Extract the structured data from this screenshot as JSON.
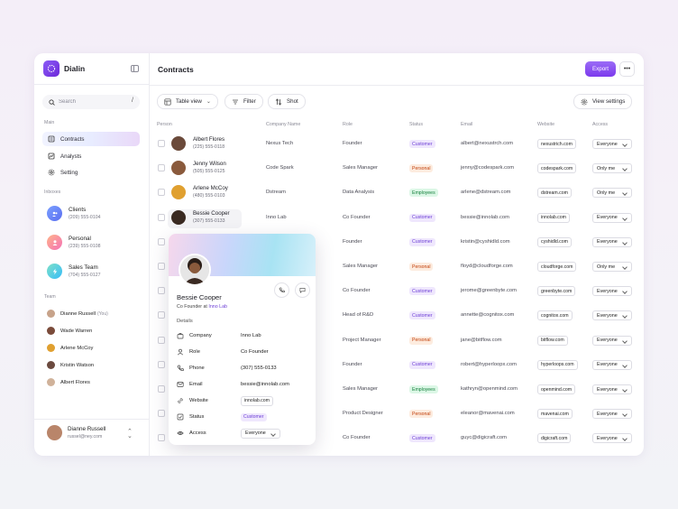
{
  "app": {
    "name": "Dialin"
  },
  "sidebar": {
    "search_placeholder": "Search",
    "search_shortcut": "/",
    "main_label": "Main",
    "main_items": [
      {
        "label": "Contracts",
        "icon": "contracts-icon"
      },
      {
        "label": "Analysts",
        "icon": "analysts-icon"
      },
      {
        "label": "Setting",
        "icon": "gear-icon"
      }
    ],
    "inboxes_label": "Inboxes",
    "inboxes": [
      {
        "name": "Clients",
        "phone": "(209) 555-0104",
        "color": "#6b8bf5"
      },
      {
        "name": "Personal",
        "phone": "(239) 555-0108",
        "color": "#f59e6b"
      },
      {
        "name": "Sales Team",
        "phone": "(704) 555-0127",
        "color": "#34c3b4"
      }
    ],
    "team_label": "Team",
    "team": [
      {
        "name": "Dianne Russell",
        "suffix": "(You)"
      },
      {
        "name": "Wade Warren",
        "suffix": ""
      },
      {
        "name": "Arlene McCoy",
        "suffix": ""
      },
      {
        "name": "Kristin Watson",
        "suffix": ""
      },
      {
        "name": "Albert Flores",
        "suffix": ""
      }
    ],
    "user": {
      "name": "Dianne Russell",
      "email": "russel@ney.com"
    }
  },
  "main": {
    "title": "Contracts",
    "export_label": "Export",
    "toolbar": {
      "table_view": "Table view",
      "filter": "Filter",
      "sort": "Shot",
      "view_settings": "View settings"
    },
    "columns": [
      "Person",
      "Company Name",
      "Role",
      "Status",
      "Email",
      "Website",
      "Access"
    ],
    "rows": [
      {
        "name": "Albert Flores",
        "phone": "(225) 555-0118",
        "company": "Nexus Tech",
        "role": "Founder",
        "status": "Customer",
        "email": "albert@nexustrch.com",
        "website": "nexustrich.com",
        "access": "Everyone"
      },
      {
        "name": "Jenny Wilson",
        "phone": "(505) 555-0125",
        "company": "Code Spark",
        "role": "Sales Manager",
        "status": "Personal",
        "email": "jenny@codespark.com",
        "website": "codespark.com",
        "access": "Only me"
      },
      {
        "name": "Arlene McCoy",
        "phone": "(480) 555-0103",
        "company": "Dstream",
        "role": "Data Analysis",
        "status": "Employees",
        "email": "arlene@dstream.com",
        "website": "dstream.com",
        "access": "Only me"
      },
      {
        "name": "Bessie Cooper",
        "phone": "(307) 555-0133",
        "company": "Inno Lab",
        "role": "Co Founder",
        "status": "Customer",
        "email": "bessie@innolab.com",
        "website": "innolab.com",
        "access": "Everyone"
      },
      {
        "name": "",
        "phone": "",
        "company": "",
        "role": "Founder",
        "status": "Customer",
        "email": "kristin@cyshidld.com",
        "website": "cyshidld.com",
        "access": "Everyone"
      },
      {
        "name": "",
        "phone": "",
        "company": "",
        "role": "Sales Manager",
        "status": "Personal",
        "email": "floyd@cloudforge.com",
        "website": "cloudforge.com",
        "access": "Only me"
      },
      {
        "name": "",
        "phone": "",
        "company": "",
        "role": "Co Founder",
        "status": "Customer",
        "email": "jerome@greenbyte.com",
        "website": "greenbyte.com",
        "access": "Everyone"
      },
      {
        "name": "",
        "phone": "",
        "company": "",
        "role": "Head of R&D",
        "status": "Customer",
        "email": "annette@cognitox.com",
        "website": "cognitox.com",
        "access": "Everyone"
      },
      {
        "name": "",
        "phone": "",
        "company": "",
        "role": "Project Manager",
        "status": "Personal",
        "email": "jane@bitflow.com",
        "website": "bitflow.com",
        "access": "Everyone"
      },
      {
        "name": "",
        "phone": "",
        "company": "",
        "role": "Founder",
        "status": "Customer",
        "email": "robert@hyperloopx.com",
        "website": "hyperloops.com",
        "access": "Everyone"
      },
      {
        "name": "",
        "phone": "",
        "company": "",
        "role": "Sales Manager",
        "status": "Employees",
        "email": "kathryn@openmind.com",
        "website": "openmind.com",
        "access": "Everyone"
      },
      {
        "name": "",
        "phone": "",
        "company": "",
        "role": "Product Designer",
        "status": "Personal",
        "email": "eleanor@mavenai.com",
        "website": "mavenai.com",
        "access": "Everyone"
      },
      {
        "name": "",
        "phone": "",
        "company": "",
        "role": "Co Founder",
        "status": "Customer",
        "email": "guyc@digicraft.com",
        "website": "digicraft.com",
        "access": "Everyone"
      }
    ]
  },
  "card": {
    "name": "Bessie Cooper",
    "role_prefix": "Co Founder at",
    "role_link": "Inno Lab",
    "details_label": "Details",
    "fields": [
      {
        "key": "Company",
        "value": "Inno Lab",
        "icon": "briefcase-icon"
      },
      {
        "key": "Role",
        "value": "Co Founder",
        "icon": "user-icon"
      },
      {
        "key": "Phone",
        "value": "(307) 555-0133",
        "icon": "phone-icon"
      },
      {
        "key": "Email",
        "value": "bessie@innolab.com",
        "icon": "mail-icon"
      },
      {
        "key": "Website",
        "value": "innolab.com",
        "icon": "link-icon"
      },
      {
        "key": "Status",
        "value": "Customer",
        "icon": "status-icon"
      },
      {
        "key": "Access",
        "value": "Everyone",
        "icon": "eye-icon"
      }
    ]
  },
  "colors": {
    "accent": "#7c3aed",
    "customer": "#6d3fd6",
    "personal": "#c2410c",
    "employees": "#15803d"
  }
}
